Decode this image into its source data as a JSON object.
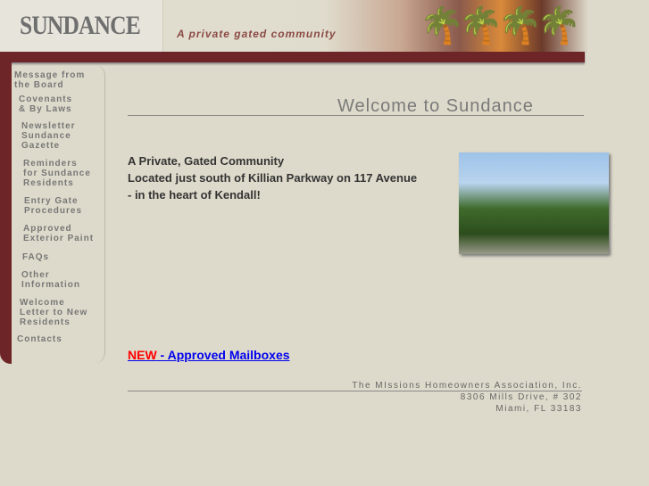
{
  "header": {
    "logo": "SUNDANCE",
    "tagline": "A private gated community"
  },
  "nav": [
    "Message from\nthe Board",
    "Covenants\n& By Laws",
    "Newsletter\nSundance\nGazette",
    "Reminders\nfor Sundance\nResidents",
    "Entry Gate\nProcedures",
    "Approved\nExterior Paint",
    "FAQs",
    "Other\nInformation",
    "Welcome\nLetter to New\nResidents",
    "Contacts"
  ],
  "main": {
    "title": "Welcome to Sundance",
    "intro": [
      "A Private, Gated Community",
      "Located just south of Killian Parkway on 117 Avenue",
      "- in the heart of Kendall!"
    ],
    "news_new": "NEW",
    "news_link": " - Approved Mailboxes"
  },
  "footer": {
    "org": "The MIssions Homeowners Association, Inc.",
    "street": "8306 Mills Drive, # 302",
    "city": "Miami, FL 33183"
  }
}
